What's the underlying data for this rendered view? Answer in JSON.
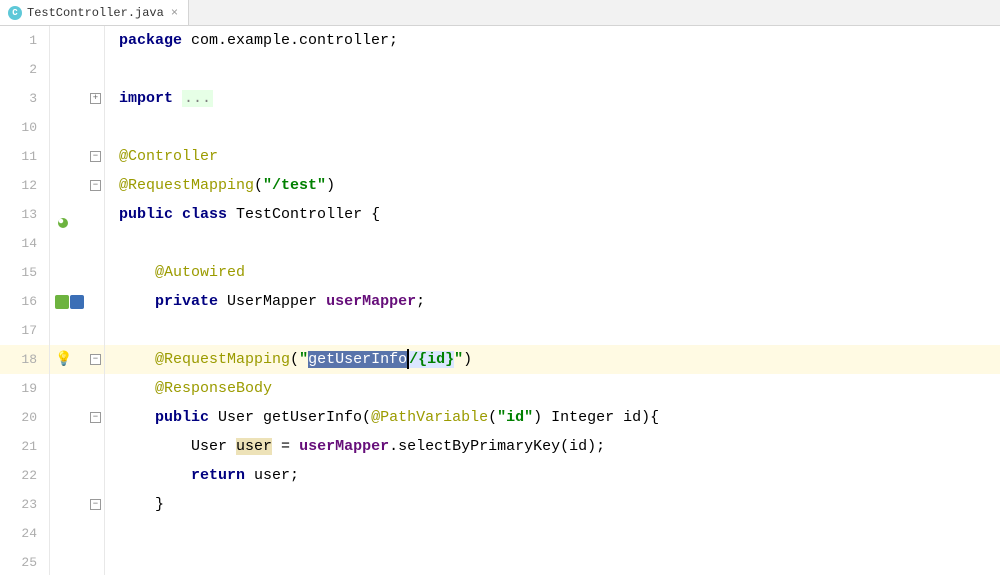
{
  "tab": {
    "filename": "TestController.java",
    "icon_letter": "C"
  },
  "line_numbers": [
    1,
    2,
    3,
    10,
    11,
    12,
    13,
    14,
    15,
    16,
    17,
    18,
    19,
    20,
    21,
    22,
    23,
    24,
    25
  ],
  "code": {
    "l1_kw": "package",
    "l1_rest": " com.example.controller;",
    "l3_kw": "import",
    "l3_folded": "...",
    "l11_anno": "@Controller",
    "l12_anno": "@RequestMapping",
    "l12_paren_open": "(",
    "l12_str": "\"/test\"",
    "l12_paren_close": ")",
    "l13_kw1": "public",
    "l13_kw2": "class",
    "l13_name": " TestController {",
    "l15_anno": "@Autowired",
    "l16_kw": "private",
    "l16_type": " UserMapper ",
    "l16_field": "userMapper",
    "l16_end": ";",
    "l18_anno": "@RequestMapping",
    "l18_paren_open": "(",
    "l18_str_q1": "\"",
    "l18_str_sel": "getUserInfo",
    "l18_str_mid": "/",
    "l18_str_rest": "{id}",
    "l18_str_q2": "\"",
    "l18_paren_close": ")",
    "l19_anno": "@ResponseBody",
    "l20_kw": "public",
    "l20_type": " User getUserInfo(",
    "l20_anno": "@PathVariable",
    "l20_p1": "(",
    "l20_str": "\"id\"",
    "l20_p2": ") Integer id){",
    "l21_type": "User ",
    "l21_var": "user",
    "l21_eq": " = ",
    "l21_field": "userMapper",
    "l21_call": ".selectByPrimaryKey(id);",
    "l22_kw": "return",
    "l22_rest": " user;",
    "l23_brace": "}"
  }
}
